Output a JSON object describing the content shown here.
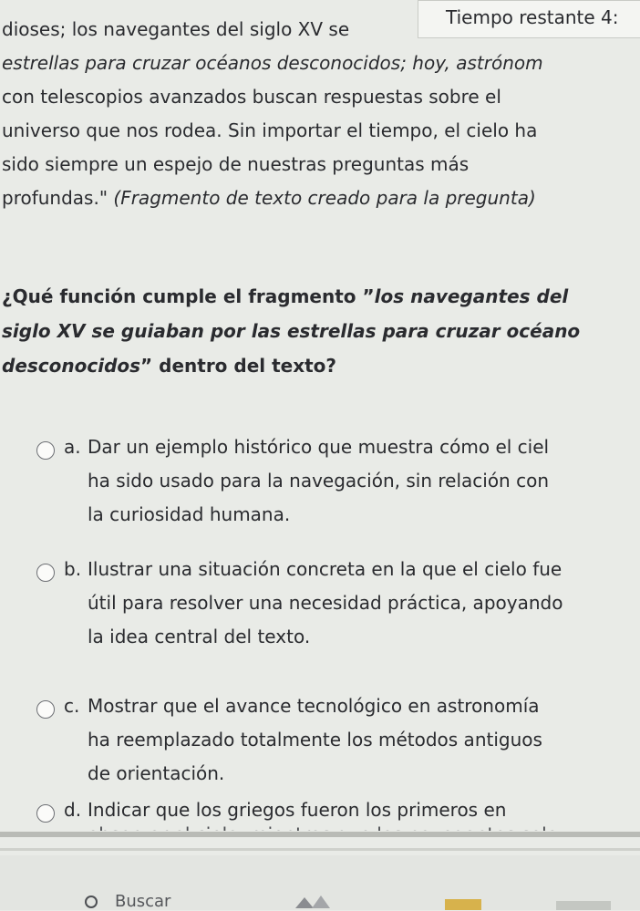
{
  "timer": {
    "label": "Tiempo restante 4:"
  },
  "passage": {
    "lines": [
      {
        "text": "dioses; los navegantes del siglo XV se"
      },
      {
        "text": "estrellas para cruzar océanos desconocidos; hoy, astrónom"
      },
      {
        "text": "con telescopios avanzados buscan respuestas sobre el"
      },
      {
        "text": "universo que nos rodea. Sin importar el tiempo, el cielo ha"
      },
      {
        "text": "sido siempre un espejo de nuestras preguntas más"
      },
      {
        "text": "profundas.\"",
        "italic": "(Fragmento de texto creado para la pregunta)"
      }
    ]
  },
  "question": {
    "line1_a": "¿Qué función cumple el fragmento ”",
    "line1_b": "los navegantes del",
    "line2": "siglo XV se guiaban por las estrellas para cruzar océano",
    "line3_a": "desconocidos",
    "line3_b": "” dentro del texto?"
  },
  "options": [
    {
      "letter": "a.",
      "lines": [
        "Dar un ejemplo histórico que muestra cómo el ciel",
        "ha sido usado para la navegación, sin relación con",
        "la curiosidad humana."
      ]
    },
    {
      "letter": "b.",
      "lines": [
        "Ilustrar una situación concreta en la que el cielo fue",
        "útil para resolver una necesidad práctica, apoyando",
        "la idea central del texto."
      ]
    },
    {
      "letter": "c.",
      "lines": [
        "Mostrar que el avance tecnológico en astronomía",
        "ha reemplazado totalmente los métodos antiguos",
        "de orientación."
      ]
    },
    {
      "letter": "d.",
      "lines": [
        "Indicar que los griegos fueron los primeros en"
      ]
    }
  ],
  "option_d_cutoff": "observar el cielo, mientras que los navegantes solo",
  "taskbar": {
    "search_label": "Buscar"
  }
}
